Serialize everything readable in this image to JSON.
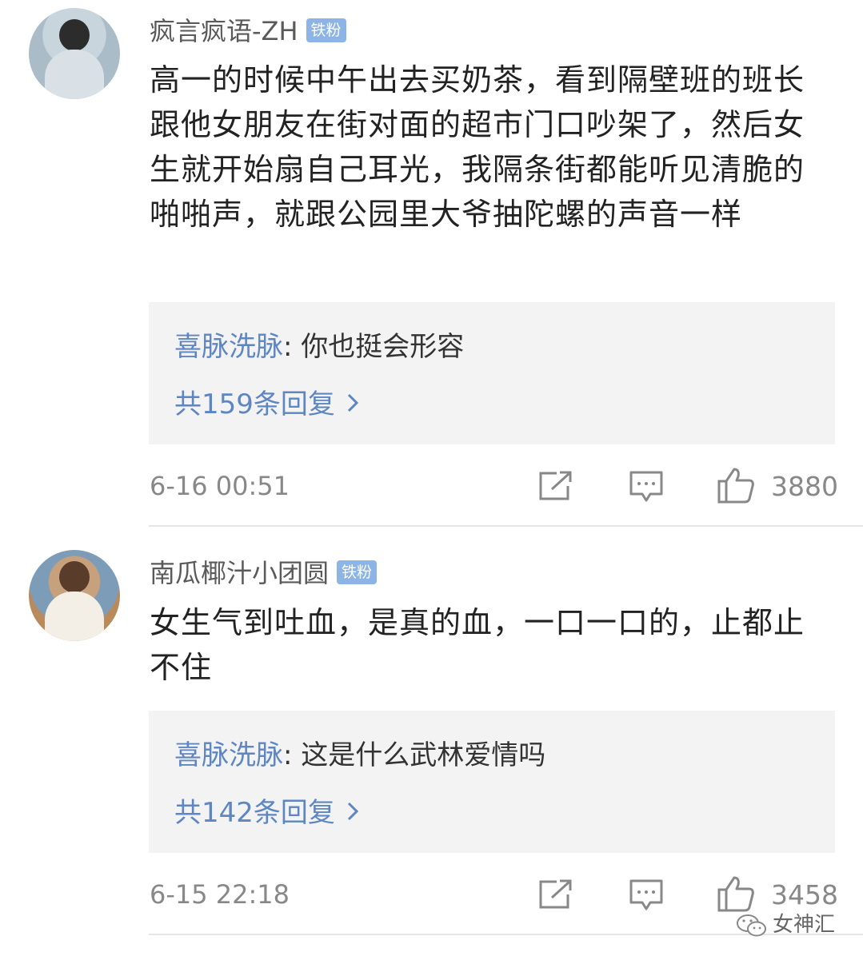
{
  "comments": [
    {
      "username": "疯言疯语-ZH",
      "badge": "铁粉",
      "text": "高一的时候中午出去买奶茶，看到隔壁班的班长跟他女朋友在街对面的超市门口吵架了，然后女生就开始扇自己耳光，我隔条街都能听见清脆的啪啪声，就跟公园里大爷抽陀螺的声音一样",
      "reply_user": "喜脉洗脉",
      "reply_text": ": 你也挺会形容",
      "reply_count": "共159条回复",
      "time": "6-16 00:51",
      "likes": "3880"
    },
    {
      "username": "南瓜椰汁小团圆",
      "badge": "铁粉",
      "text": "女生气到吐血，是真的血，一口一口的，止都止不住",
      "reply_user": "喜脉洗脉",
      "reply_text": ": 这是什么武林爱情吗",
      "reply_count": "共142条回复",
      "time": "6-15 22:18",
      "likes": "3458"
    }
  ],
  "watermark": "女神汇",
  "icons": {
    "share": "share-icon",
    "comment": "comment-icon",
    "like": "thumbs-up-icon",
    "chevron": "chevron-right-icon"
  },
  "colors": {
    "link_blue": "#5d86c2",
    "badge_blue": "#8db4e6",
    "reply_bg": "#f3f3f3"
  }
}
